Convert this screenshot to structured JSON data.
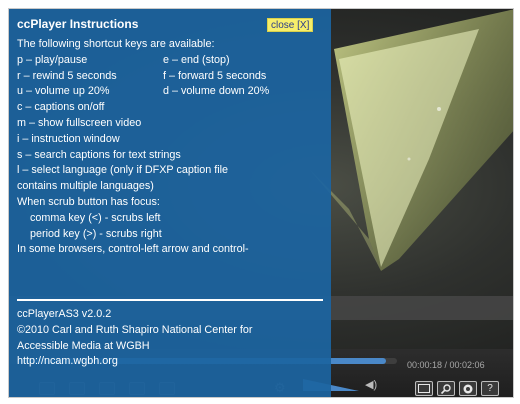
{
  "panel": {
    "title": "ccPlayer Instructions",
    "close_label": "close [X]",
    "intro": "The following shortcut keys are available:",
    "shortcut_pairs": [
      [
        "p – play/pause",
        "e – end (stop)"
      ],
      [
        "r – rewind 5 seconds",
        "f – forward 5 seconds"
      ],
      [
        "u – volume up 20%",
        "d – volume down 20%"
      ]
    ],
    "lines": [
      "c – captions on/off",
      "m – show fullscreen video",
      "i – instruction window",
      "s – search captions for text strings",
      "l – select language (only if DFXP caption file",
      "contains multiple languages)",
      "When scrub button has focus:"
    ],
    "scrub_lines": [
      "comma key (<) - scrubs left",
      "period key (>) - scrubs right"
    ],
    "last_line": "In some browsers, control-left arrow and control-",
    "about": [
      "ccPlayerAS3 v2.0.2",
      "©2010 Carl and Ruth Shapiro National Center for",
      "Accessible Media at WGBH",
      "http://ncam.wgbh.org"
    ]
  },
  "controls": {
    "time": "00:00:18 / 00:02:06",
    "progress": 0.97,
    "volume_level": 0.8,
    "icons": [
      "captions-icon",
      "search-icon",
      "language-icon",
      "help-icon"
    ],
    "help_label": "?"
  },
  "colors": {
    "panel_bg": "#1c64a0",
    "close_bg": "#f6ee6a",
    "accent": "#4a88c8"
  }
}
